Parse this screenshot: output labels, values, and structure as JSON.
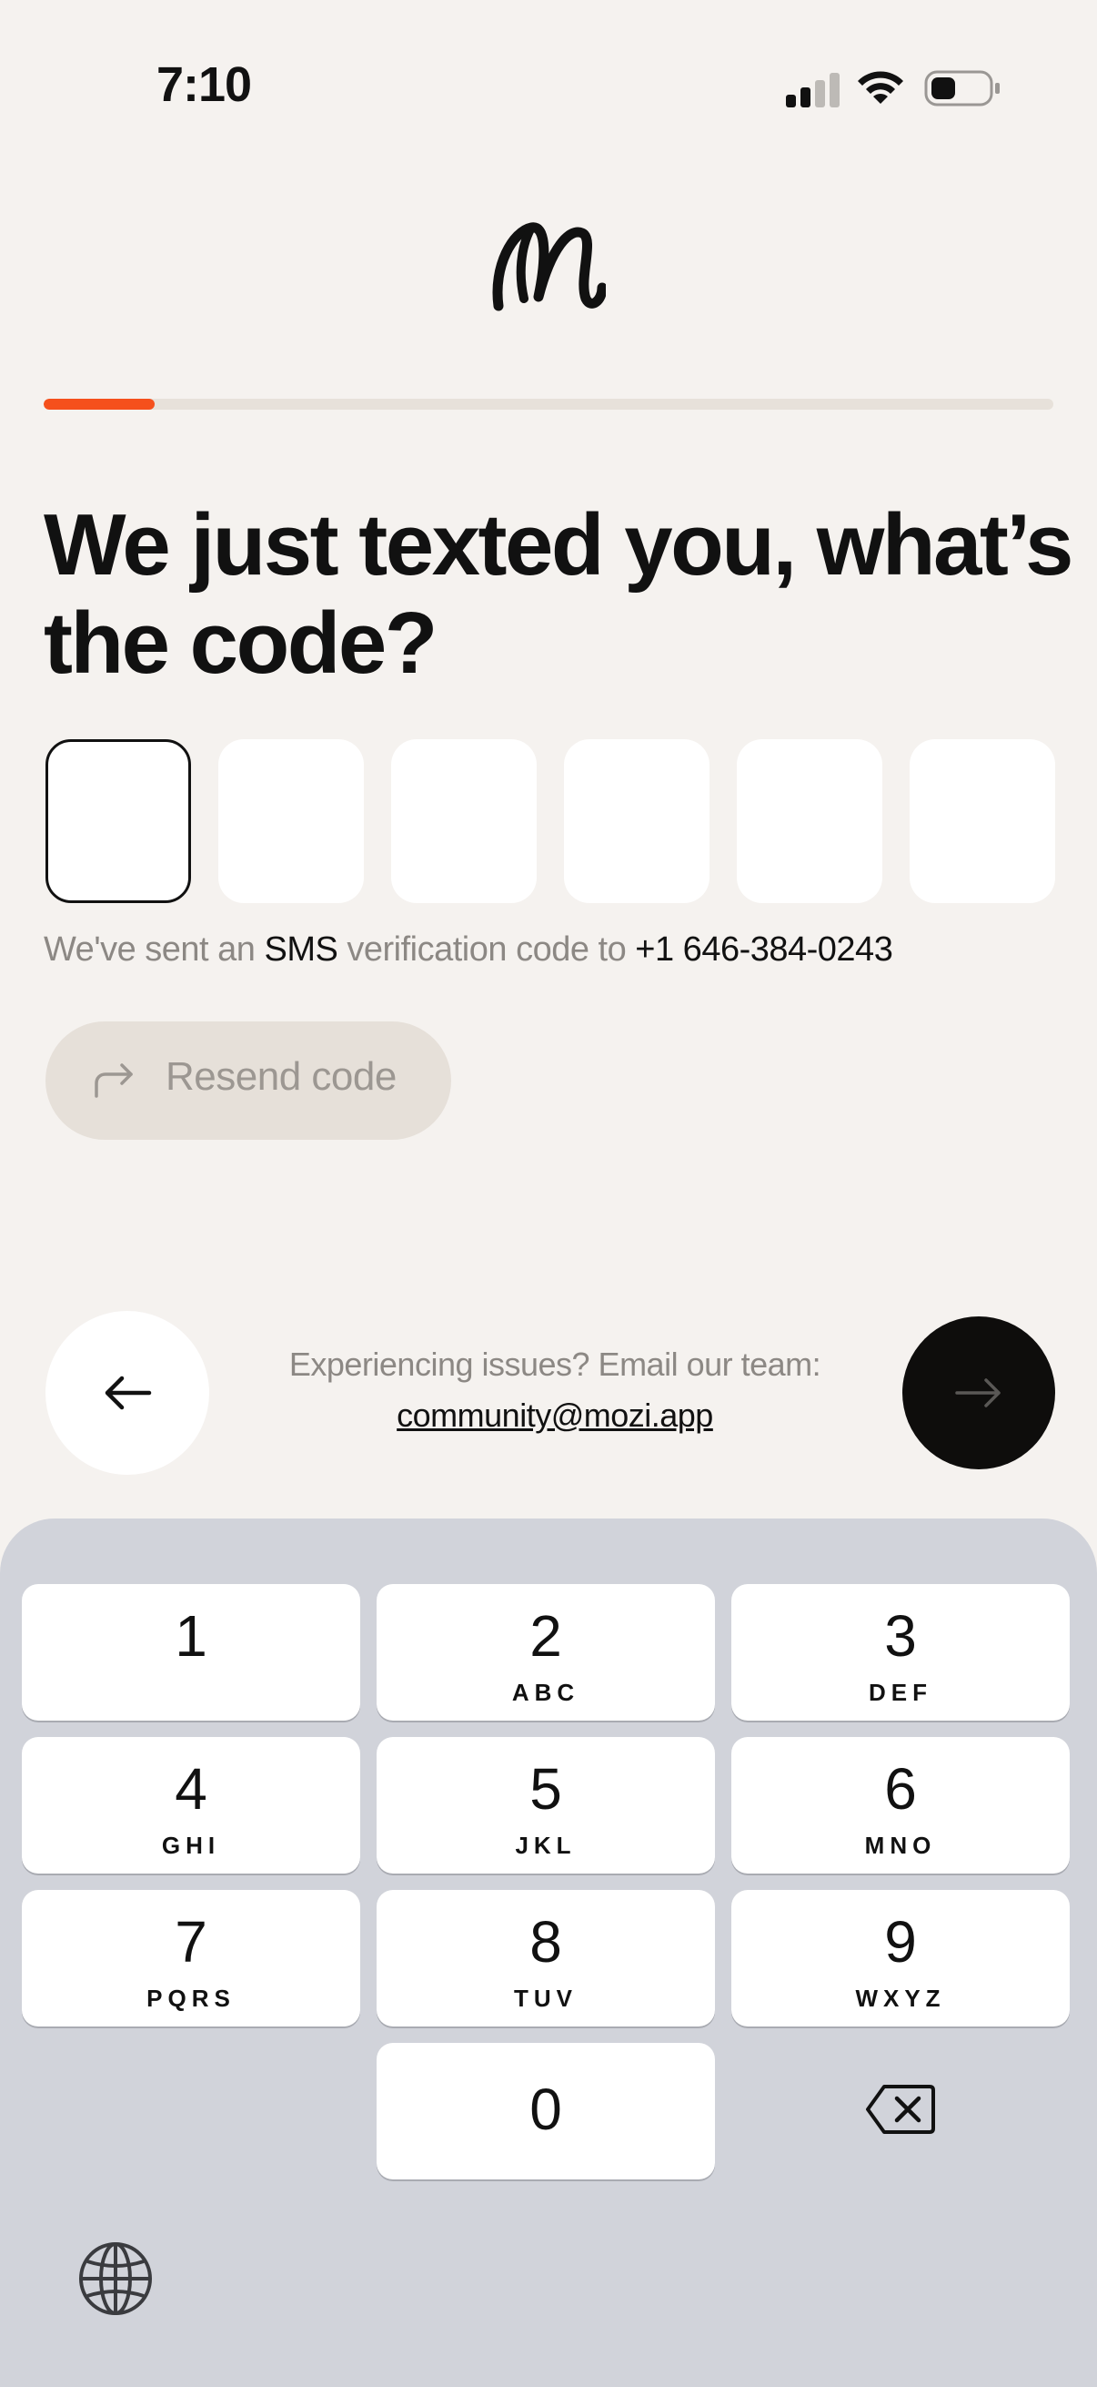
{
  "status_bar": {
    "time": "7:10"
  },
  "progress": {
    "fraction": 0.11
  },
  "headline": "We just texted you, what’s the code?",
  "code_inputs": {
    "count": 6,
    "values": [
      "",
      "",
      "",
      "",
      "",
      ""
    ]
  },
  "sent_message": {
    "prefix": "We've sent an ",
    "channel": "SMS",
    "middle": " verification code to ",
    "phone": "+1 646-384-0243"
  },
  "resend_button": {
    "label": "Resend code"
  },
  "help": {
    "text": "Experiencing issues? Email our team:",
    "email": "community@mozi.app"
  },
  "colors": {
    "background": "#f5f2ef",
    "accent": "#f5501c",
    "primary_button": "#0e0d0c",
    "keyboard": "#d1d3da"
  },
  "keyboard": {
    "keys": [
      {
        "digit": "1",
        "letters": ""
      },
      {
        "digit": "2",
        "letters": "ABC"
      },
      {
        "digit": "3",
        "letters": "DEF"
      },
      {
        "digit": "4",
        "letters": "GHI"
      },
      {
        "digit": "5",
        "letters": "JKL"
      },
      {
        "digit": "6",
        "letters": "MNO"
      },
      {
        "digit": "7",
        "letters": "PQRS"
      },
      {
        "digit": "8",
        "letters": "TUV"
      },
      {
        "digit": "9",
        "letters": "WXYZ"
      },
      {
        "digit": "0",
        "letters": ""
      }
    ]
  },
  "icons": {
    "logo": "mozi-logo-icon",
    "back": "arrow-left-icon",
    "next": "arrow-right-icon",
    "resend": "share-arrow-icon",
    "backspace": "backspace-icon",
    "globe": "globe-icon"
  }
}
